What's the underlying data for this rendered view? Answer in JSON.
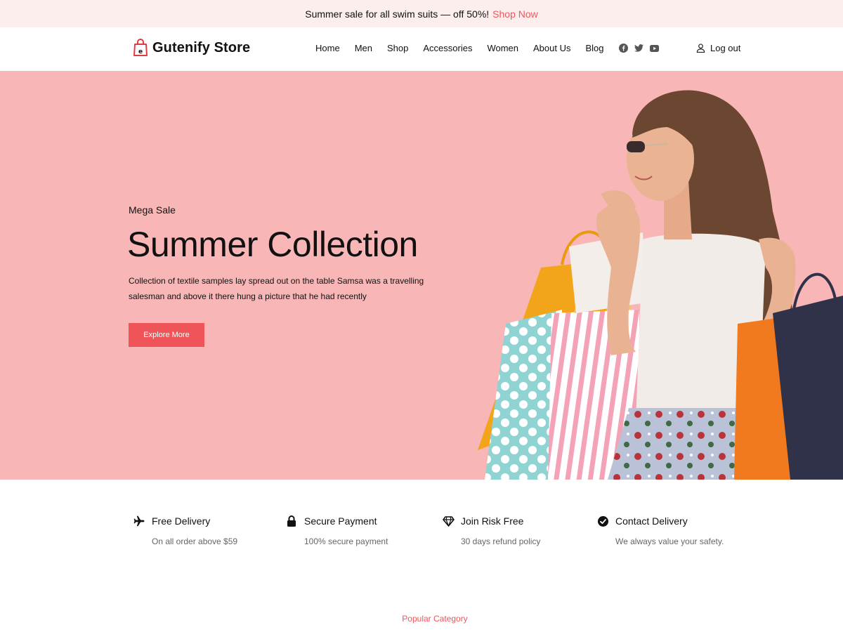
{
  "promo": {
    "text": "Summer sale for all swim suits — off 50%!",
    "link": "Shop Now"
  },
  "header": {
    "brand": "Gutenify Store",
    "nav": [
      "Home",
      "Men",
      "Shop",
      "Accessories",
      "Women",
      "About Us",
      "Blog"
    ],
    "social": [
      "facebook-icon",
      "twitter-icon",
      "youtube-icon"
    ],
    "logout": "Log out"
  },
  "hero": {
    "eyebrow": "Mega Sale",
    "title": "Summer Collection",
    "description": "Collection of textile samples lay spread out on the table Samsa was a travelling salesman and above it there hung a picture that he had recently",
    "button": "Explore More",
    "background": "#f8b6b6",
    "accent": "#ef5458"
  },
  "features": [
    {
      "icon": "airplane-icon",
      "title": "Free Delivery",
      "subtitle": "On all order above $59"
    },
    {
      "icon": "lock-icon",
      "title": "Secure Payment",
      "subtitle": "100% secure payment"
    },
    {
      "icon": "diamond-icon",
      "title": "Join Risk Free",
      "subtitle": "30 days refund policy"
    },
    {
      "icon": "check-circle-icon",
      "title": "Contact Delivery",
      "subtitle": "We always value your safety."
    }
  ],
  "popular_category": "Popular Category"
}
